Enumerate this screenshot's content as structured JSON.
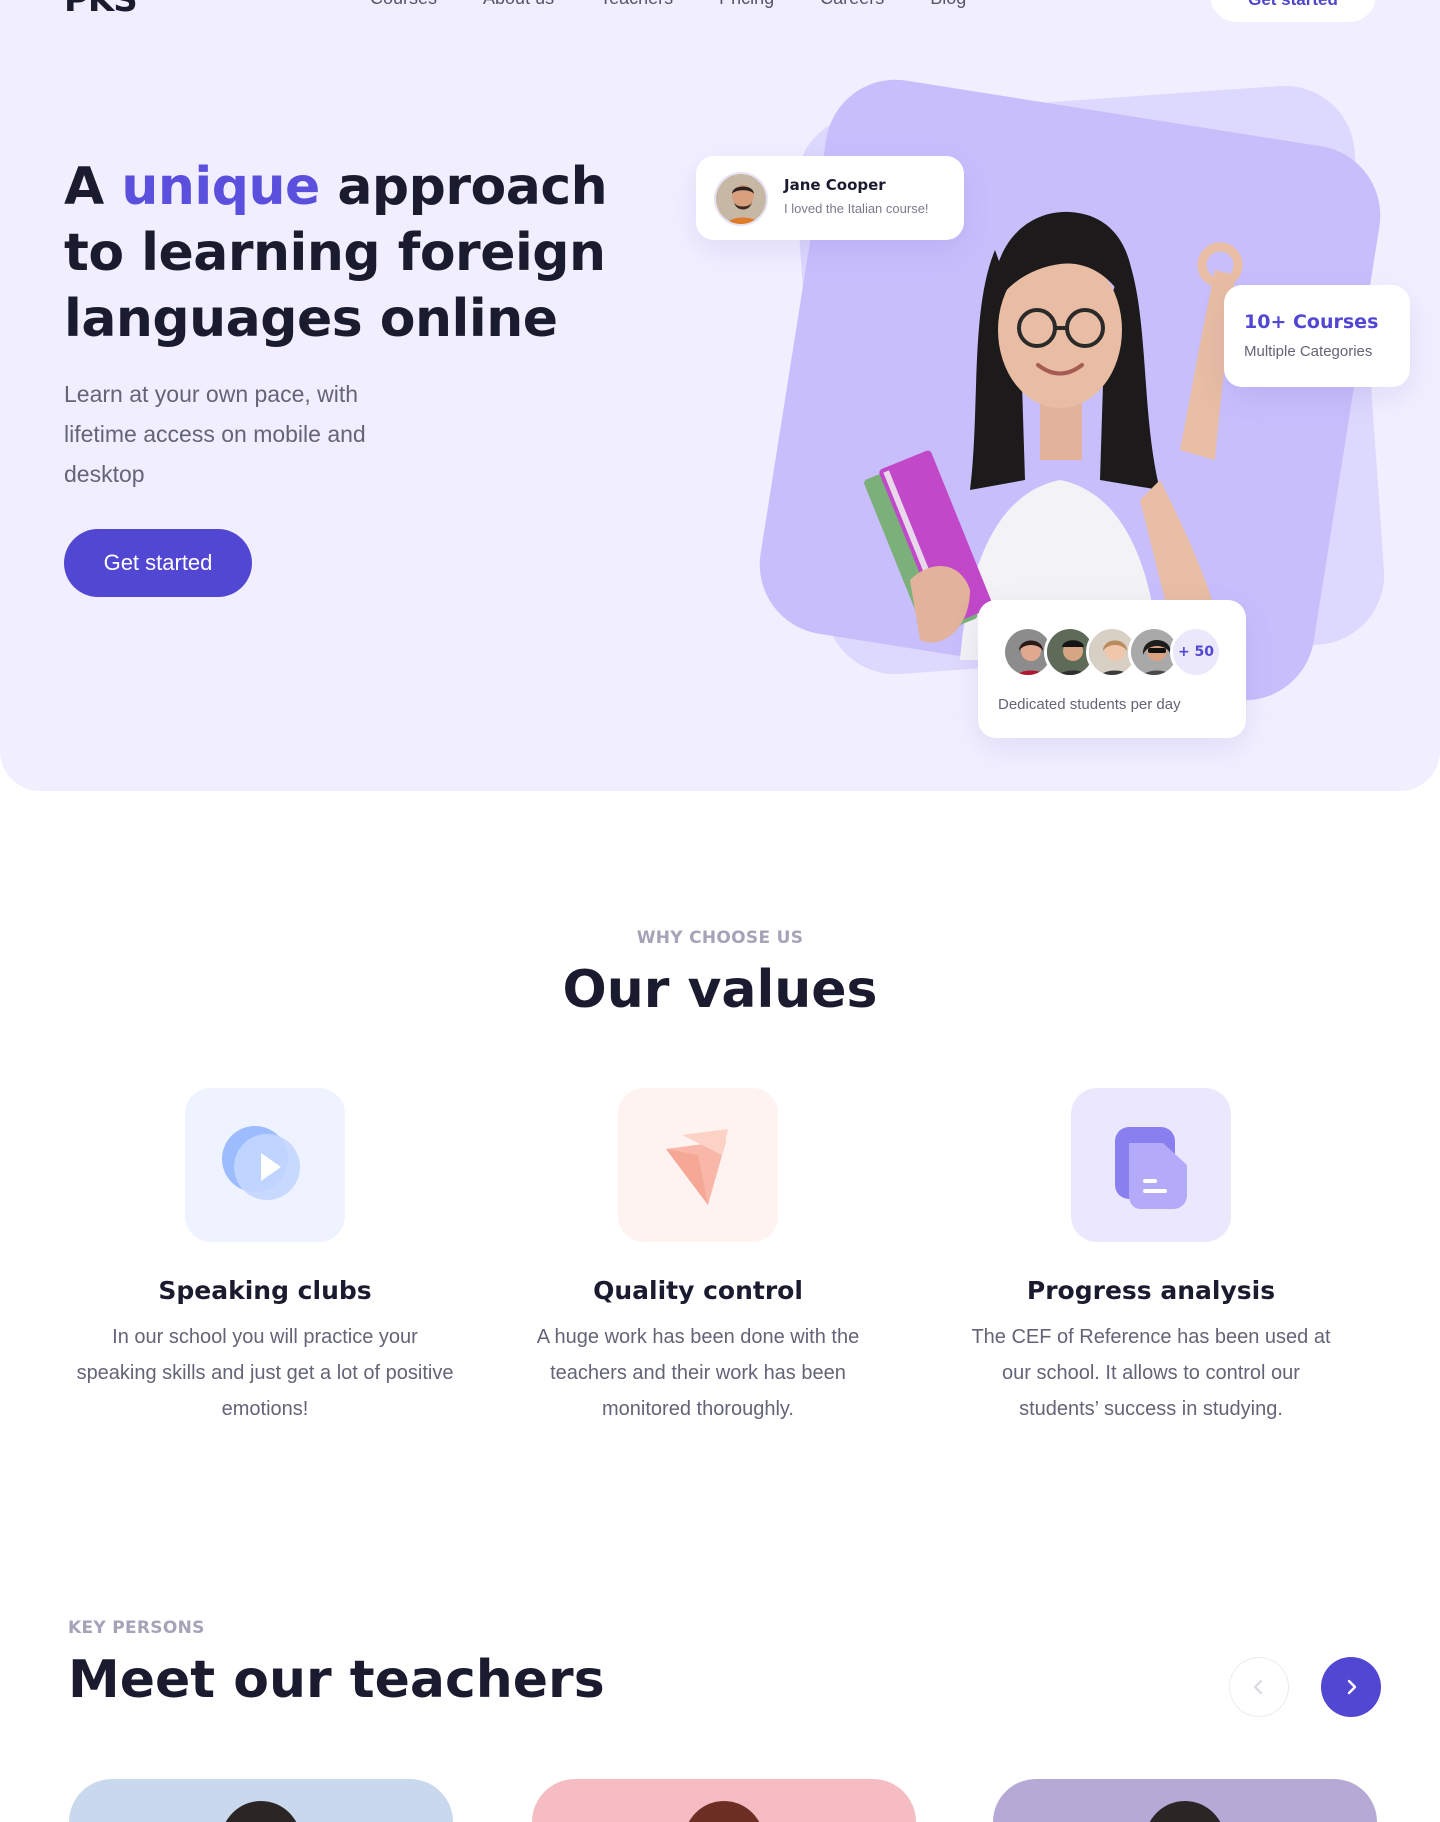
{
  "nav": {
    "logo": "PKS",
    "links": [
      "Courses",
      "About us",
      "Teachers",
      "Pricing",
      "Careers",
      "Blog"
    ],
    "cta_label": "Get started"
  },
  "hero": {
    "title_before": "A ",
    "title_accent": "unique",
    "title_after": " approach to learning foreign languages online",
    "subtitle": "Learn at your own pace, with lifetime access on mobile and desktop",
    "button_label": "Get started",
    "testimonial": {
      "name": "Jane Cooper",
      "quote": "I loved the Italian course!"
    },
    "courses": {
      "title": "10+ Courses",
      "subtitle": "Multiple Categories"
    },
    "students": {
      "more": "+ 50",
      "label": "Dedicated students per day"
    }
  },
  "values": {
    "eyebrow": "WHY CHOOSE US",
    "title": "Our values",
    "items": [
      {
        "title": "Speaking clubs",
        "text": "In our school you will practice your speaking skills and just get a lot of positive emotions!"
      },
      {
        "title": "Quality control",
        "text": "A huge work has been done with the teachers and their work has been monitored thoroughly."
      },
      {
        "title": "Progress analysis",
        "text": "The CEF of Reference has been used at our school. It allows to control our students’ success in studying."
      }
    ]
  },
  "teachers": {
    "eyebrow": "KEY PERSONS",
    "title": "Meet our teachers"
  },
  "colors": {
    "accent": "#5247d2",
    "hero_bg": "#f1efff",
    "heading": "#1b1b2f",
    "body_text": "#646478"
  }
}
